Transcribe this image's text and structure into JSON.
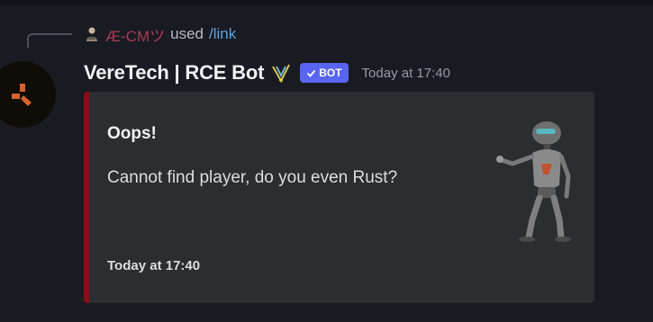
{
  "reply": {
    "user_name": "Æ-CMツ",
    "used_text": "used",
    "command": "/link",
    "avatar_icon": "user-avatar-icon"
  },
  "message": {
    "username": "VereTech | RCE Bot",
    "badge_emoji": "verified-trident-icon",
    "bot_tag": "BOT",
    "timestamp": "Today at 17:40",
    "avatar_icon": "rust-logo-icon"
  },
  "embed": {
    "accent_color": "#8a0f14",
    "title": "Oops!",
    "description": "Cannot find player, do you even Rust?",
    "footer": "Today at 17:40",
    "thumbnail_icon": "robot-thumbnail-icon"
  },
  "colors": {
    "background": "#1a1b22",
    "embed_background": "#2b2d31",
    "bot_tag": "#5865f2",
    "reply_name": "#a83a57",
    "command_link": "#5aa0e0"
  }
}
